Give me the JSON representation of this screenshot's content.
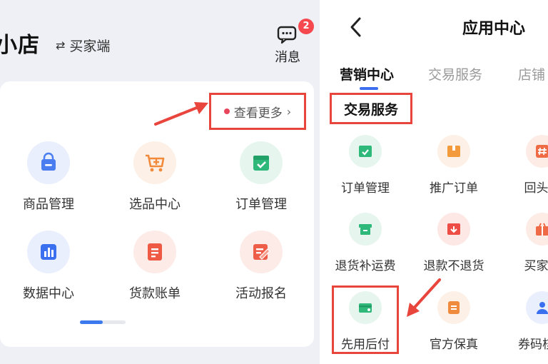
{
  "left": {
    "shop_title": "小店",
    "switch_label": "买家端",
    "switch_icon": "swap-icon",
    "messages": {
      "label": "消息",
      "badge": "2"
    },
    "see_more": "查看更多",
    "grid": [
      {
        "label": "商品管理",
        "icon": "shopping-bag-icon",
        "color": "#4a7df0"
      },
      {
        "label": "选品中心",
        "icon": "cart-plus-icon",
        "color": "#f28a3c"
      },
      {
        "label": "订单管理",
        "icon": "order-check-icon",
        "color": "#2eb87a"
      },
      {
        "label": "数据中心",
        "icon": "bar-chart-icon",
        "color": "#3a6ff0"
      },
      {
        "label": "货款账单",
        "icon": "bill-icon",
        "color": "#ef5a45"
      },
      {
        "label": "活动报名",
        "icon": "edit-form-icon",
        "color": "#ee5d47"
      }
    ]
  },
  "right": {
    "title": "应用中心",
    "tabs": [
      {
        "label": "营销中心",
        "active": true
      },
      {
        "label": "交易服务",
        "active": false
      },
      {
        "label": "店铺",
        "active": false
      }
    ],
    "section_title": "交易服务",
    "services": [
      {
        "label": "订单管理",
        "icon": "order-check-icon",
        "color": "#2eb87a"
      },
      {
        "label": "推广订单",
        "icon": "promo-box-icon",
        "color": "#f39a3c"
      },
      {
        "label": "回头客",
        "icon": "hash-icon",
        "color": "#ef6b45"
      },
      {
        "label": "退货补运费",
        "icon": "return-box-icon",
        "color": "#2eb87a"
      },
      {
        "label": "退款不退货",
        "icon": "refund-icon",
        "color": "#ee4d45"
      },
      {
        "label": "买家秀",
        "icon": "gift-icon",
        "color": "#ef6b45"
      },
      {
        "label": "先用后付",
        "icon": "card-icon",
        "color": "#2eb87a"
      },
      {
        "label": "官方保真",
        "icon": "shield-badge-icon",
        "color": "#f08a3c"
      },
      {
        "label": "券码核销",
        "icon": "user-icon",
        "color": "#3a6ff0"
      }
    ]
  },
  "annotations": {
    "color": "#e8453c"
  }
}
